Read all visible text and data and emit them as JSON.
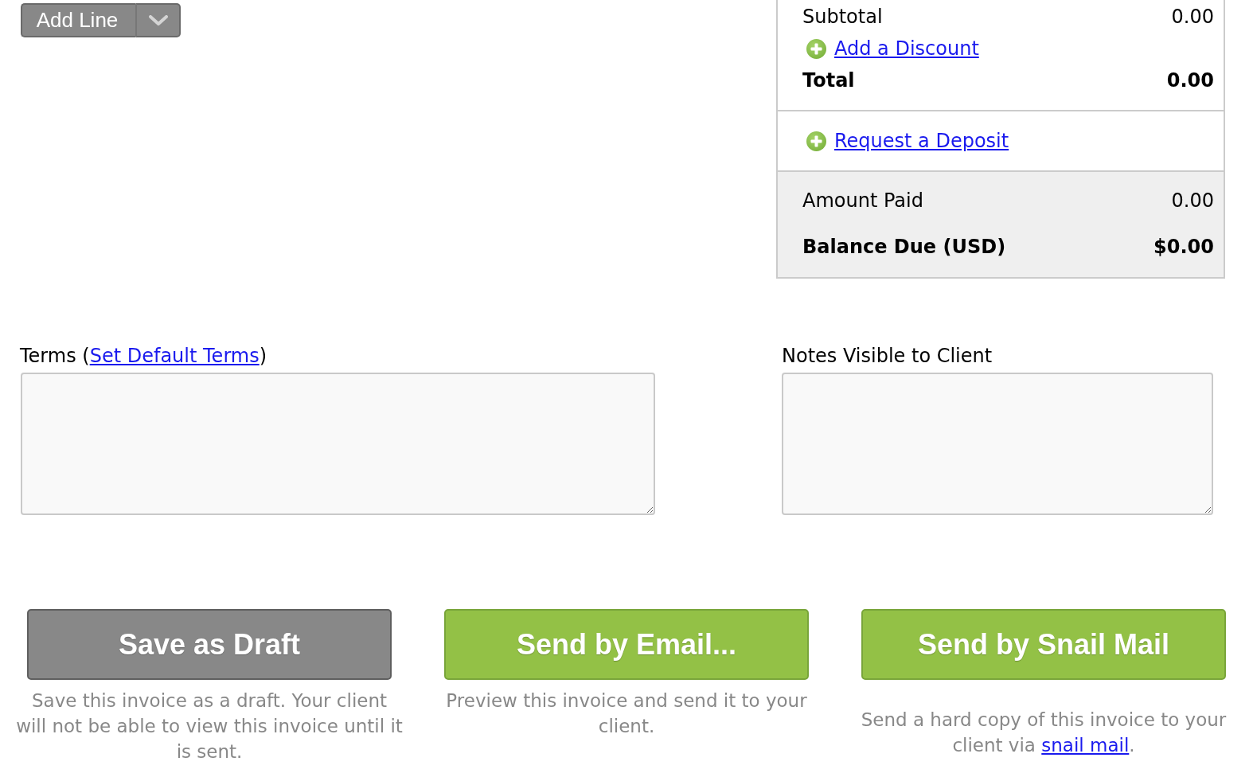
{
  "add_line": {
    "label": "Add Line"
  },
  "summary": {
    "sections": [
      {
        "shaded": false,
        "rows": [
          {
            "kind": "amount",
            "label": "Subtotal",
            "value": "0.00"
          },
          {
            "kind": "link",
            "label": "Add a Discount"
          },
          {
            "kind": "total",
            "label": "Total",
            "value": "0.00"
          }
        ]
      },
      {
        "shaded": false,
        "rows": [
          {
            "kind": "link",
            "label": "Request a Deposit"
          }
        ]
      },
      {
        "shaded": true,
        "rows": [
          {
            "kind": "amount",
            "label": "Amount Paid",
            "value": "0.00"
          },
          {
            "kind": "total",
            "label": "Balance Due (USD)",
            "value": "$0.00"
          }
        ]
      }
    ]
  },
  "terms": {
    "label_before": "Terms (",
    "link": "Set Default Terms",
    "label_after": ")"
  },
  "notes": {
    "label": "Notes Visible to Client"
  },
  "actions": [
    {
      "kind": "draft",
      "label": "Save as Draft",
      "description": {
        "text": "Save this invoice as a draft. Your client will not be able to view this invoice until it is sent."
      }
    },
    {
      "kind": "send",
      "label": "Send by Email...",
      "description": {
        "text": "Preview this invoice and send it to your client."
      }
    },
    {
      "kind": "send",
      "label": "Send by Snail Mail",
      "description": {
        "text": "Send a hard copy of this invoice to your client via ",
        "link": "snail mail",
        "after": "."
      }
    }
  ]
}
